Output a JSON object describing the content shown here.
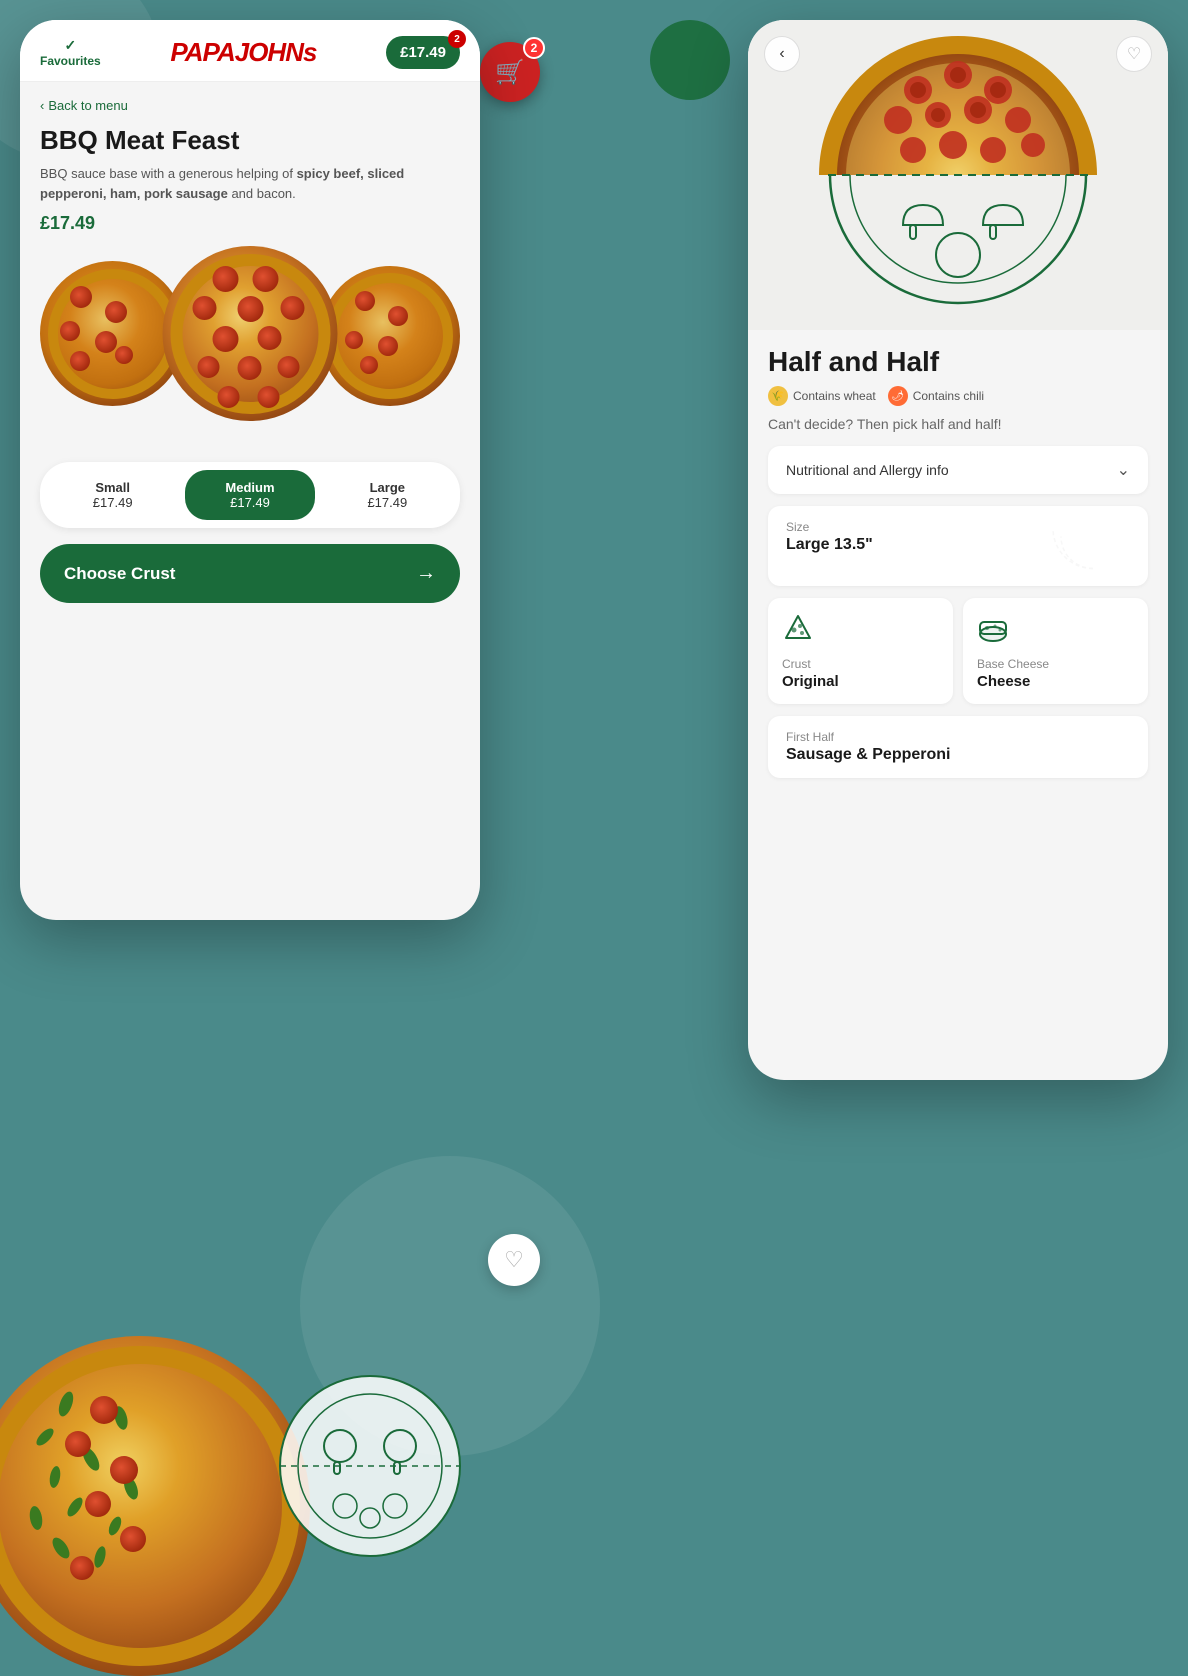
{
  "app": {
    "name": "Papa Johns"
  },
  "left_phone": {
    "header": {
      "favourites_label": "Favourites",
      "logo": "PAPAJOHNs",
      "cart_price": "£17.49",
      "cart_badge": "2"
    },
    "back_label": "Back to menu",
    "pizza": {
      "name": "BBQ Meat Feast",
      "description_plain": "BBQ sauce base with a generous helping of ",
      "description_bold": "spicy beef, sliced pepperoni, ham, pork sausage",
      "description_end": " and bacon.",
      "price": "£17.49"
    },
    "sizes": [
      {
        "name": "Small",
        "price": "£17.49",
        "active": false
      },
      {
        "name": "Medium",
        "price": "£17.49",
        "active": true
      },
      {
        "name": "Large",
        "price": "£17.49",
        "active": false
      }
    ],
    "cta": {
      "label": "Choose Crust",
      "arrow": "→"
    }
  },
  "right_phone": {
    "pizza": {
      "name": "Half and Half",
      "subtitle": "Can't decide? Then pick half and half!",
      "allergens": [
        {
          "icon": "wheat",
          "label": "Contains wheat"
        },
        {
          "icon": "chili",
          "label": "Contains chili"
        }
      ]
    },
    "nutrition": {
      "label": "Nutritional and Allergy info",
      "chevron": "⌄"
    },
    "size": {
      "label": "Size",
      "value": "Large 13.5\""
    },
    "crust": {
      "label": "Crust",
      "value": "Original"
    },
    "base_cheese": {
      "label": "Base Cheese",
      "value": "Cheese"
    },
    "first_half": {
      "label": "First Half",
      "value": "Sausage & Pepperoni"
    }
  },
  "floating": {
    "cart_count": "2",
    "heart": "♡"
  }
}
